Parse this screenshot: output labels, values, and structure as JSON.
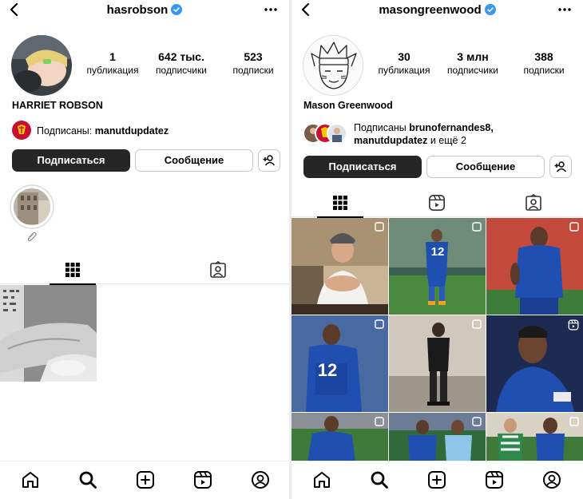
{
  "left": {
    "username": "hasrobson",
    "stats": [
      {
        "value": "1",
        "label": "публикация"
      },
      {
        "value": "642 тыс.",
        "label": "подписчики"
      },
      {
        "value": "523",
        "label": "подписки"
      }
    ],
    "display_name": "HARRIET ROBSON",
    "followed_prefix": "Подписаны: ",
    "followed_accounts": "manutdupdatez",
    "follow_button": "Подписаться",
    "message_button": "Сообщение"
  },
  "right": {
    "username": "masongreenwood",
    "stats": [
      {
        "value": "30",
        "label": "публикация"
      },
      {
        "value": "3 млн",
        "label": "подписчики"
      },
      {
        "value": "388",
        "label": "подписки"
      }
    ],
    "display_name": "Mason Greenwood",
    "followed_line1_prefix": "Подписаны ",
    "followed_line1_account": "brunofernandes8,",
    "followed_line2_account": "manutdupdatez",
    "followed_line2_suffix": " и ещё 2",
    "follow_button": "Подписаться",
    "message_button": "Сообщение"
  },
  "icons": {
    "back": "chevron-left-icon",
    "verified": "verified-badge-icon",
    "more": "more-dots-icon",
    "grid": "grid-icon",
    "reels": "reels-icon",
    "tagged": "tagged-icon",
    "add_user": "add-user-icon",
    "home": "home-icon",
    "search": "search-icon",
    "create": "create-icon",
    "profile": "profile-icon"
  },
  "colors": {
    "verified_blue": "#3897f0",
    "button_dark": "#262626",
    "getafe_blue": "#1f4fb0",
    "club_red": "#c8102e"
  }
}
